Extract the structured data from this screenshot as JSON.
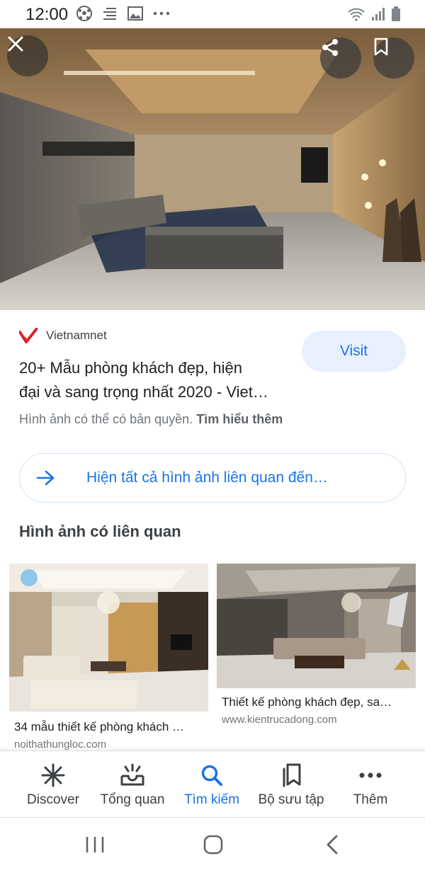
{
  "status_bar": {
    "time": "12:00",
    "left_icons": [
      "soccer-ball-icon",
      "notification-lines-icon",
      "image-icon",
      "more-dots-icon"
    ],
    "right_icons": [
      "wifi-icon",
      "signal-icon",
      "battery-icon"
    ]
  },
  "hero": {
    "close_icon": "close-icon",
    "share_icon": "share-icon",
    "save_icon": "bookmark-icon"
  },
  "result": {
    "source_name": "Vietnamnet",
    "visit_label": "Visit",
    "title_line1": "20+ Mẫu phòng khách đẹp, hiện",
    "title_line2": "đại và sang trọng nhất 2020 - Viet…",
    "copyright_text": "Hình ảnh có thể có bản quyền.",
    "learn_more": "Tìm hiểu thêm"
  },
  "related_link": {
    "label": "Hiện tất cả hình ảnh liên quan đến…"
  },
  "related_section": {
    "title": "Hình ảnh có liên quan",
    "cards": [
      {
        "title": "34 mẫu thiết kế phòng khách …",
        "domain": "noithathungloc.com"
      },
      {
        "title": "Thiết kế phòng khách đẹp, sa…",
        "domain": "www.kientrucadong.com"
      }
    ]
  },
  "bottom_nav": {
    "items": [
      {
        "label": "Discover",
        "icon": "asterisk-icon"
      },
      {
        "label": "Tổng quan",
        "icon": "updates-tray-icon"
      },
      {
        "label": "Tìm kiếm",
        "icon": "search-icon",
        "active": true
      },
      {
        "label": "Bộ sưu tập",
        "icon": "collections-bookmark-icon"
      },
      {
        "label": "Thêm",
        "icon": "more-horizontal-icon"
      }
    ]
  },
  "system_nav": {
    "icons": [
      "recents-icon",
      "home-icon",
      "back-icon"
    ]
  },
  "colors": {
    "accent": "#1a73e8",
    "visit_bg": "#e8f0fe",
    "text_primary": "#202124",
    "text_secondary": "#70757a"
  }
}
